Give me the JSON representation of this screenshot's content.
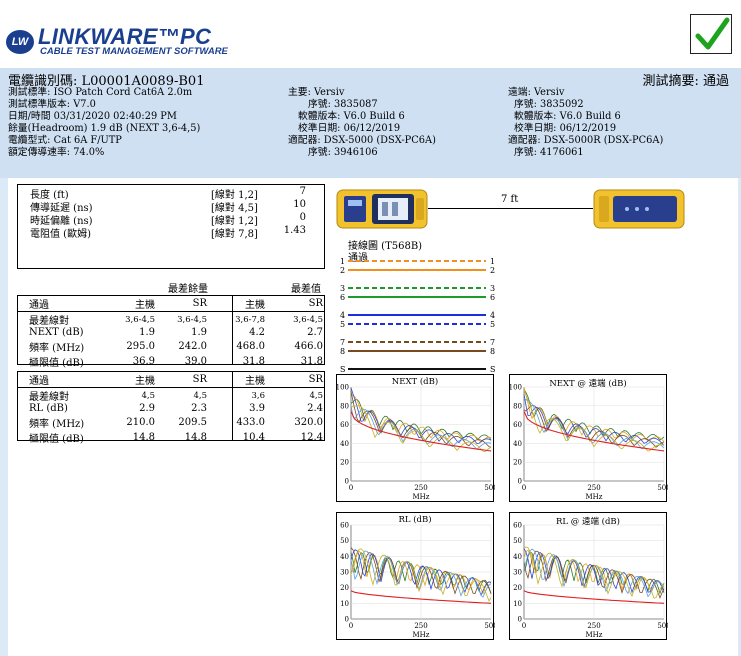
{
  "header": {
    "logo_badge": "LW",
    "logo_main": "LINKWARE™PC",
    "logo_sub": "CABLE TEST MANAGEMENT SOFTWARE",
    "cable_id": "電纜識別碼: L00001A0089-B01",
    "summary": "測試摘要: 通過",
    "left_info": [
      "測試標準: ISO Patch Cord Cat6A 2.0m",
      "測試標準版本: V7.0",
      "日期/時間 03/31/2020  02:40:29 PM",
      "餘量(Headroom) 1.9 dB (NEXT 3,6-4,5)",
      "電纜型式: Cat 6A F/UTP",
      "額定傳導速率: 74.0%"
    ],
    "main_info": [
      "主要: Versiv",
      "序號: 3835087",
      "軟體版本: V6.0 Build 6",
      "校準日期: 06/12/2019",
      "適配器: DSX-5000 (DSX-PC6A)",
      "序號: 3946106"
    ],
    "remote_info": [
      "遠端: Versiv",
      "序號: 3835092",
      "軟體版本: V6.0 Build 6",
      "校準日期: 06/12/2019",
      "適配器: DSX-5000R (DSX-PC6A)",
      "序號: 4176061"
    ]
  },
  "length_table": [
    {
      "label": "長度 (ft)",
      "pair": "[線對 1,2]",
      "value": "7"
    },
    {
      "label": "傳導延遲 (ns)",
      "pair": "[線對 4,5]",
      "value": "10"
    },
    {
      "label": "時延偏離 (ns)",
      "pair": "[線對 1,2]",
      "value": "0"
    },
    {
      "label": "電阻值 (歐姆)",
      "pair": "[線對 7,8]",
      "value": "1.43"
    }
  ],
  "margin_headers": {
    "worst_margin": "最差餘量",
    "worst_value": "最差值"
  },
  "next_table": {
    "header": [
      "通過",
      "主機",
      "SR",
      "主機",
      "SR"
    ],
    "rows": [
      [
        "最差線對",
        "3,6-4,5",
        "3,6-4,5",
        "3,6-7,8",
        "3,6-4,5"
      ],
      [
        "NEXT (dB)",
        "1.9",
        "1.9",
        "4.2",
        "2.7"
      ],
      [
        "頻率 (MHz)",
        "295.0",
        "242.0",
        "468.0",
        "466.0"
      ],
      [
        "極限值 (dB)",
        "36.9",
        "39.0",
        "31.8",
        "31.8"
      ]
    ]
  },
  "rl_table": {
    "header": [
      "通過",
      "主機",
      "SR",
      "主機",
      "SR"
    ],
    "rows": [
      [
        "最差線對",
        "4,5",
        "4,5",
        "3,6",
        "4,5"
      ],
      [
        "RL (dB)",
        "2.9",
        "2.3",
        "3.9",
        "2.4"
      ],
      [
        "頻率 (MHz)",
        "210.0",
        "209.5",
        "433.0",
        "320.0"
      ],
      [
        "極限值 (dB)",
        "14.8",
        "14.8",
        "10.4",
        "12.4"
      ]
    ]
  },
  "wiremap": {
    "length_label": "7 ft",
    "title": "接線圖 (T568B)",
    "status": "通過",
    "pairs": [
      {
        "left": "1",
        "right": "1",
        "color": "#f0901e",
        "dashed": true
      },
      {
        "left": "2",
        "right": "2",
        "color": "#f0901e",
        "dashed": false
      },
      {
        "left": "3",
        "right": "3",
        "color": "#1f9a2e",
        "dashed": true
      },
      {
        "left": "6",
        "right": "6",
        "color": "#1f9a2e",
        "dashed": false
      },
      {
        "left": "4",
        "right": "4",
        "color": "#1d2fd8",
        "dashed": false
      },
      {
        "left": "5",
        "right": "5",
        "color": "#1d2fd8",
        "dashed": true
      },
      {
        "left": "7",
        "right": "7",
        "color": "#7a4a1e",
        "dashed": true
      },
      {
        "left": "8",
        "right": "8",
        "color": "#7a4a1e",
        "dashed": false
      },
      {
        "left": "S",
        "right": "S",
        "color": "#111111",
        "dashed": false
      }
    ]
  },
  "graphs": [
    {
      "title": "NEXT (dB)",
      "xlabel": "MHz",
      "yticks": [
        "100",
        "80",
        "60",
        "40",
        "20",
        "0"
      ],
      "xticks": [
        "0",
        "250",
        "500"
      ],
      "kind": "next"
    },
    {
      "title": "NEXT @ 遠端 (dB)",
      "xlabel": "MHz",
      "yticks": [
        "100",
        "80",
        "60",
        "40",
        "20",
        "0"
      ],
      "xticks": [
        "0",
        "250",
        "500"
      ],
      "kind": "next"
    },
    {
      "title": "RL (dB)",
      "xlabel": "MHz",
      "yticks": [
        "60",
        "50",
        "40",
        "30",
        "20",
        "10",
        "0"
      ],
      "xticks": [
        "0",
        "250",
        "500"
      ],
      "kind": "rl"
    },
    {
      "title": "RL @ 遠端 (dB)",
      "xlabel": "MHz",
      "yticks": [
        "60",
        "50",
        "40",
        "30",
        "20",
        "10",
        "0"
      ],
      "xticks": [
        "0",
        "250",
        "500"
      ],
      "kind": "rl"
    }
  ],
  "colors": {
    "header_band": "#cfe0f3",
    "brand": "#1a3f8f",
    "check": "#1ea31e"
  }
}
